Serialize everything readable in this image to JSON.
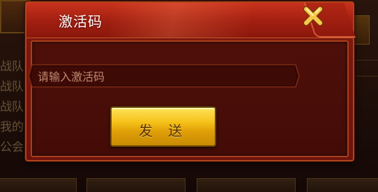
{
  "dialog": {
    "title": "激活码",
    "close_icon": "close-x-icon",
    "input": {
      "value": "",
      "placeholder": "请输入激活码"
    },
    "send_label": "发 送"
  },
  "background": {
    "side_text_lines": [
      "战队",
      "战队",
      "战队",
      "我的",
      "公会"
    ]
  },
  "colors": {
    "dialog_red": "#8e1e12",
    "header_red": "#c8321c",
    "border_orange": "#b0441c",
    "button_gold": "#f6c21a",
    "close_gold": "#f3c44a"
  }
}
